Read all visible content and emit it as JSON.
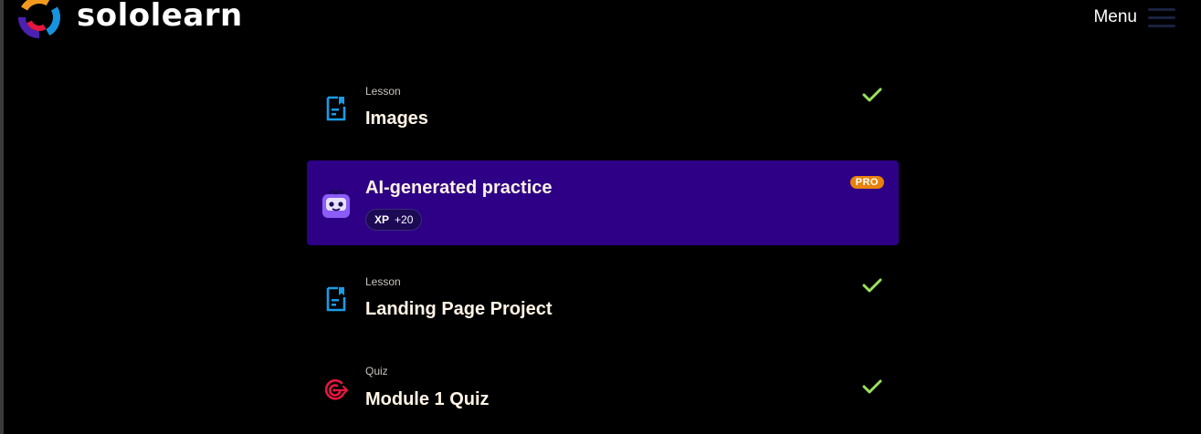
{
  "header": {
    "brand": "sololearn",
    "menu_label": "Menu",
    "colors": {
      "logo_orange": "#f29a1f",
      "logo_blue": "#1693e0",
      "logo_purple": "#4b21b2",
      "logo_red": "#e5163f"
    }
  },
  "items": [
    {
      "kind": "Lesson",
      "title": "Images",
      "icon": "lesson-doc-icon",
      "completed": true
    },
    {
      "kind": "",
      "title": "AI-generated practice",
      "icon": "ai-bot-icon",
      "badge": "PRO",
      "xp_label": "XP",
      "xp_value": "+20",
      "highlighted": true
    },
    {
      "kind": "Lesson",
      "title": "Landing Page Project",
      "icon": "lesson-doc-icon",
      "completed": true
    },
    {
      "kind": "Quiz",
      "title": "Module 1 Quiz",
      "icon": "quiz-target-icon",
      "completed": true
    }
  ],
  "colors": {
    "background": "#000000",
    "highlight": "#2d0086",
    "check": "#9be15d",
    "pro_badge": "#e9820c",
    "lesson_icon": "#1a9be8",
    "quiz_icon": "#e5163f"
  }
}
